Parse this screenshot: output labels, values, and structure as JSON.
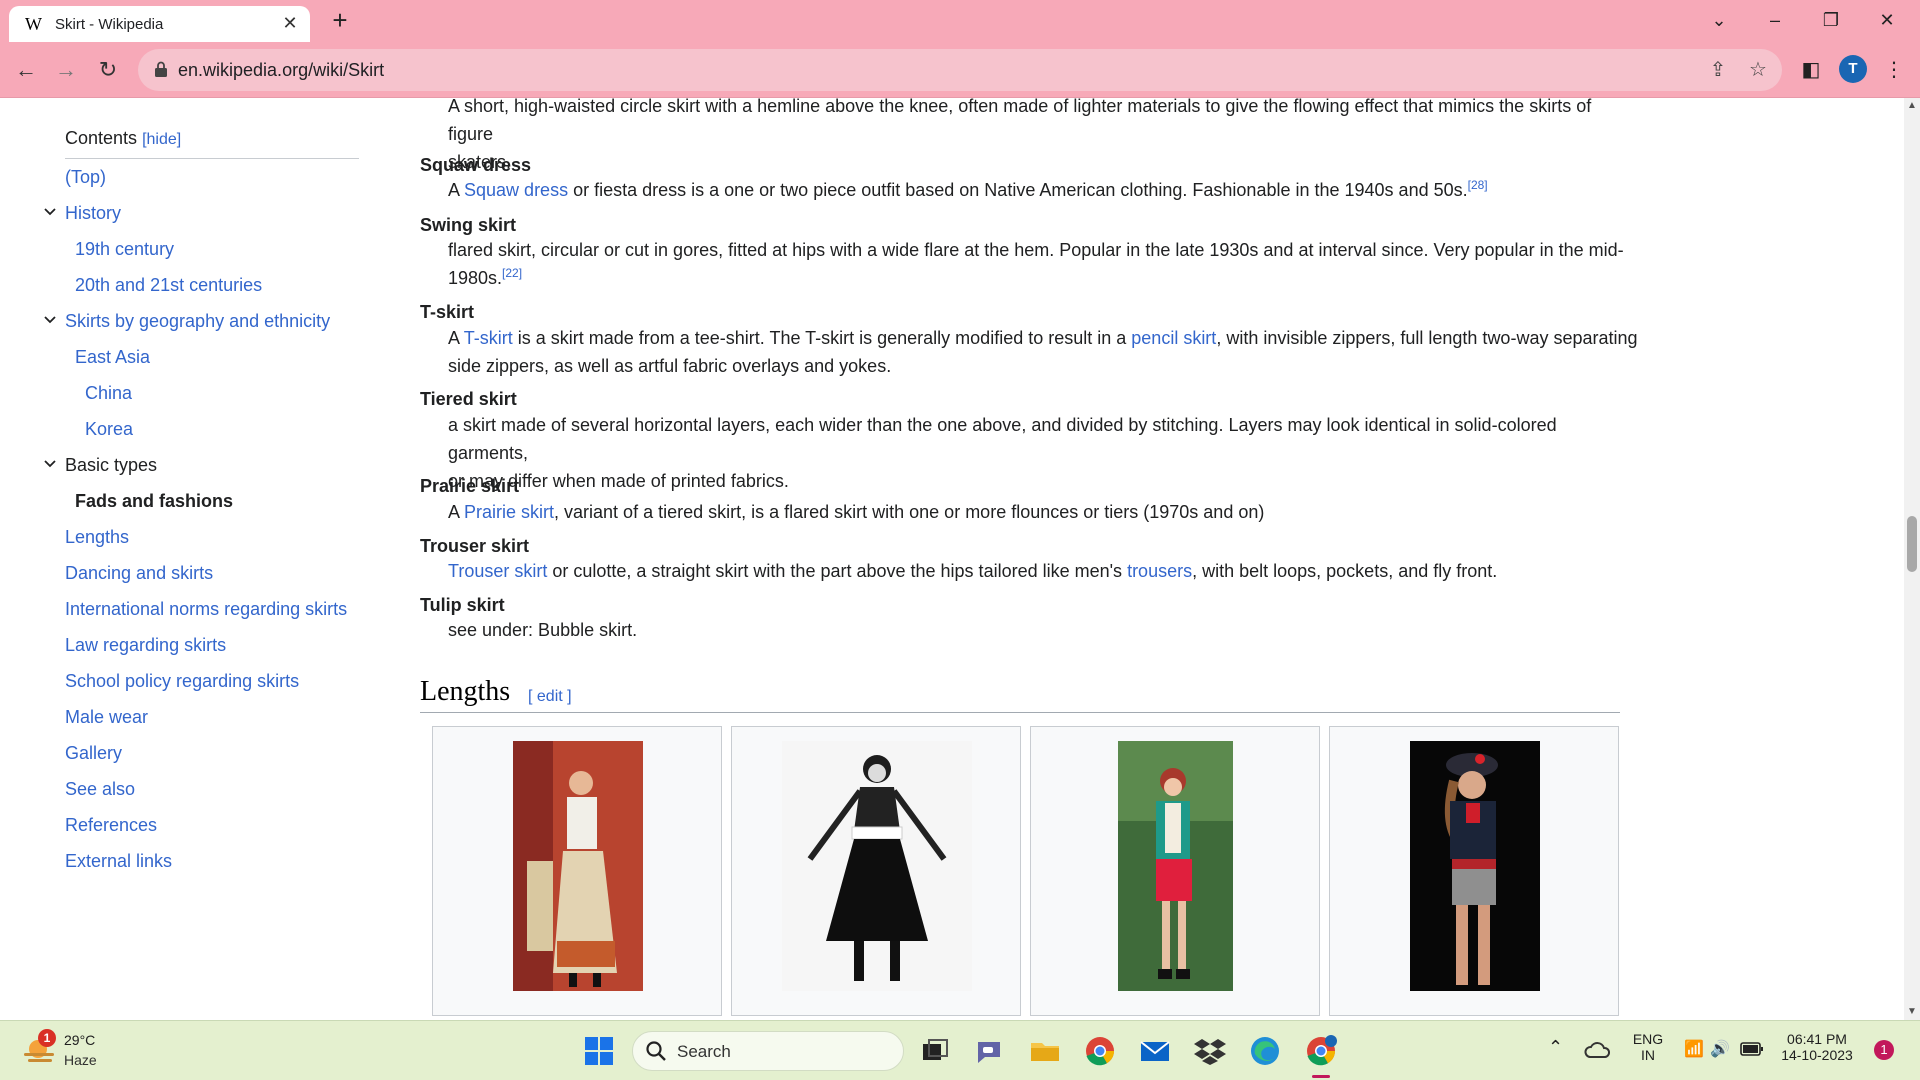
{
  "browser": {
    "tab_title": "Skirt - Wikipedia",
    "favicon": "W",
    "url": "en.wikipedia.org/wiki/Skirt",
    "profile_initial": "T"
  },
  "toc": {
    "heading": "Contents",
    "hide_label": "[hide]",
    "items": [
      {
        "label": "(Top)"
      },
      {
        "label": "History"
      },
      {
        "label": "19th century"
      },
      {
        "label": "20th and 21st centuries"
      },
      {
        "label": "Skirts by geography and ethnicity"
      },
      {
        "label": "East Asia"
      },
      {
        "label": "China"
      },
      {
        "label": "Korea"
      },
      {
        "label": "Basic types"
      },
      {
        "label": "Fads and fashions"
      },
      {
        "label": "Lengths"
      },
      {
        "label": "Dancing and skirts"
      },
      {
        "label": "International norms regarding skirts"
      },
      {
        "label": "Law regarding skirts"
      },
      {
        "label": "School policy regarding skirts"
      },
      {
        "label": "Male wear"
      },
      {
        "label": "Gallery"
      },
      {
        "label": "See also"
      },
      {
        "label": "References"
      },
      {
        "label": "External links"
      }
    ]
  },
  "content": {
    "entries": [
      {
        "term": "",
        "desc_1": "A short, high-waisted circle skirt with a hemline above the knee, often made of lighter materials to give the flowing effect that mimics the skirts of figure",
        "desc_2": "skaters."
      },
      {
        "term": "Squaw dress",
        "pre": "A ",
        "link": "Squaw dress",
        "post": " or fiesta dress is a one or two piece outfit based on Native American clothing. Fashionable in the 1940s and 50s.",
        "ref": "[28]"
      },
      {
        "term": "Swing skirt",
        "desc_1": "flared skirt, circular or cut in gores, fitted at hips with a wide flare at the hem. Popular in the late 1930s and at interval since. Very popular in the mid-",
        "desc_2": "1980s.",
        "ref": "[22]"
      },
      {
        "term": "T-skirt",
        "pre": "A ",
        "link": "T-skirt",
        "mid": " is a skirt made from a tee-shirt. The T-skirt is generally modified to result in a ",
        "link2": "pencil skirt",
        "post": ", with invisible zippers, full length two-way separating",
        "desc_2": "side zippers, as well as artful fabric overlays and yokes."
      },
      {
        "term": "Tiered skirt",
        "desc_1": "a skirt made of several horizontal layers, each wider than the one above, and divided by stitching. Layers may look identical in solid-colored garments,",
        "desc_2": "or may differ when made of printed fabrics."
      },
      {
        "term": "Prairie skirt",
        "pre": "A ",
        "link": "Prairie skirt",
        "post": ", variant of a tiered skirt, is a flared skirt with one or more flounces or tiers (1970s and on)"
      },
      {
        "term": "Trouser skirt",
        "link": "Trouser skirt",
        "mid": " or culotte, a straight skirt with the part above the hips tailored like men's ",
        "link2": "trousers",
        "post": ", with belt loops, pockets, and fly front."
      },
      {
        "term": "Tulip skirt",
        "desc_1": "see under: Bubble skirt."
      }
    ],
    "section_heading": "Lengths",
    "edit_label": "[ edit ]"
  },
  "taskbar": {
    "temperature": "29°C",
    "condition": "Haze",
    "weather_badge": "1",
    "search_label": "Search",
    "lang_1": "ENG",
    "lang_2": "IN",
    "time": "06:41 PM",
    "date": "14-10-2023",
    "notification_count": "1"
  },
  "colors": {
    "chrome": "#f7a9b8",
    "link": "#3366cc",
    "taskbar": "#e4f0cf"
  }
}
